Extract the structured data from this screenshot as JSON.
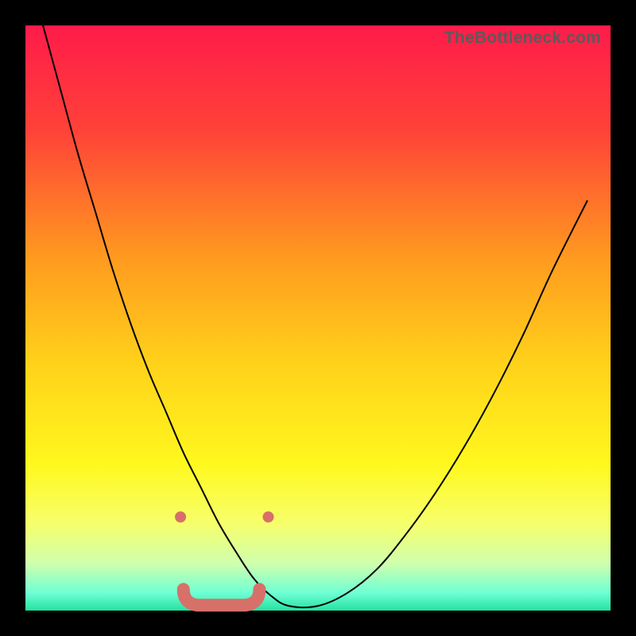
{
  "watermark": "TheBottleneck.com",
  "chart_data": {
    "type": "line",
    "title": "",
    "xlabel": "",
    "ylabel": "",
    "xlim": [
      0,
      100
    ],
    "ylim": [
      0,
      100
    ],
    "legend": false,
    "grid": false,
    "background_gradient": {
      "direction": "vertical",
      "stops": [
        {
          "pos": 0.0,
          "color": "#ff1b4a"
        },
        {
          "pos": 0.18,
          "color": "#ff4238"
        },
        {
          "pos": 0.4,
          "color": "#ff9b1f"
        },
        {
          "pos": 0.58,
          "color": "#ffd21a"
        },
        {
          "pos": 0.75,
          "color": "#fff81e"
        },
        {
          "pos": 0.85,
          "color": "#f7ff6a"
        },
        {
          "pos": 0.92,
          "color": "#cfffae"
        },
        {
          "pos": 0.97,
          "color": "#6effd4"
        },
        {
          "pos": 1.0,
          "color": "#24e2a0"
        }
      ]
    },
    "series": [
      {
        "name": "bottleneck-curve",
        "stroke": "#000000",
        "x": [
          3,
          6,
          9,
          12,
          15,
          18,
          21,
          24,
          27,
          30,
          33,
          36,
          39,
          42,
          45,
          50,
          55,
          60,
          65,
          70,
          75,
          80,
          85,
          90,
          96
        ],
        "values": [
          100,
          89,
          78,
          68,
          58,
          49,
          41,
          34,
          27,
          21,
          15,
          10,
          5.5,
          2.5,
          0.8,
          0.8,
          3,
          7,
          13,
          20,
          28,
          37,
          47,
          58,
          70
        ]
      }
    ],
    "markers": {
      "color": "#d77069",
      "optimal_range_x": [
        27,
        40
      ],
      "optimal_range_y": [
        2,
        2
      ],
      "end_dots": [
        {
          "x": 26.5,
          "y": 16
        },
        {
          "x": 41.5,
          "y": 16
        }
      ]
    }
  }
}
